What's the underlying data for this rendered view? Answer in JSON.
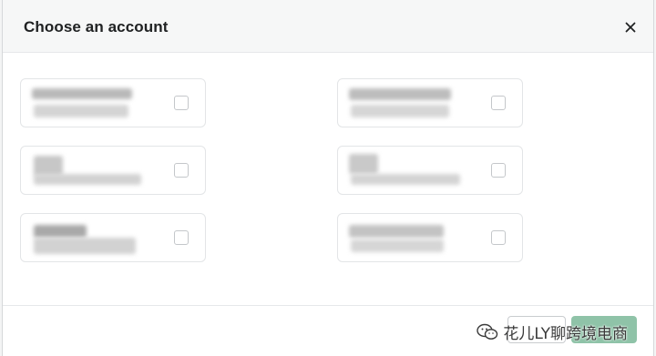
{
  "dialog": {
    "title": "Choose an account",
    "close_label": "×"
  },
  "accounts": [
    {
      "name": "",
      "id": "",
      "checked": false
    },
    {
      "name": "",
      "id": "",
      "checked": false
    },
    {
      "name": "",
      "id": "",
      "checked": false
    },
    {
      "name": "",
      "id": "",
      "checked": false
    },
    {
      "name": "",
      "id": "",
      "checked": false
    },
    {
      "name": "",
      "id": "",
      "checked": false
    }
  ],
  "footer": {
    "cancel_label": "",
    "confirm_label": ""
  },
  "watermark": {
    "text": "花儿LY聊跨境电商"
  }
}
